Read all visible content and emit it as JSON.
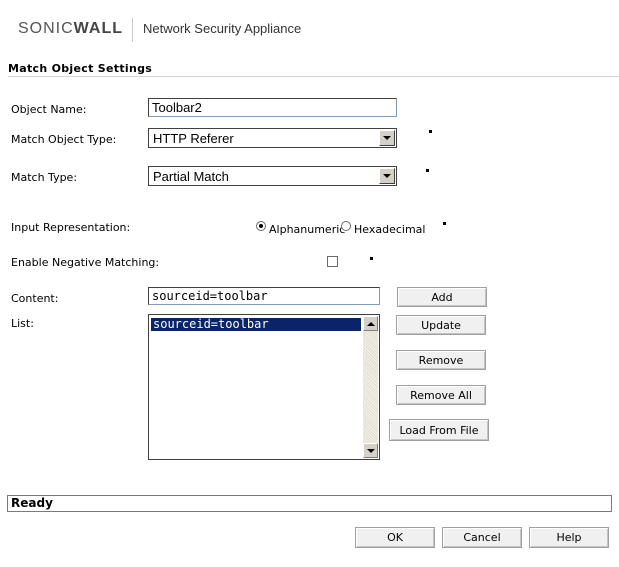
{
  "header": {
    "brand_prefix": "SONIC",
    "brand_suffix": "WALL",
    "product": "Network Security Appliance"
  },
  "section": {
    "title": "Match Object Settings"
  },
  "form": {
    "object_name": {
      "label": "Object Name:",
      "value": "Toolbar2"
    },
    "match_object_type": {
      "label": "Match Object Type:",
      "value": "HTTP Referer"
    },
    "match_type": {
      "label": "Match Type:",
      "value": "Partial Match"
    },
    "input_representation": {
      "label": "Input Representation:",
      "options": [
        "Alphanumeric",
        "Hexadecimal"
      ],
      "selected": "Alphanumeric"
    },
    "enable_negative_matching": {
      "label": "Enable Negative Matching:",
      "checked": false
    },
    "content": {
      "label": "Content:",
      "value": "sourceid=toolbar"
    },
    "list": {
      "label": "List:",
      "items": [
        "sourceid=toolbar"
      ],
      "selected_index": 0
    }
  },
  "buttons": {
    "add": "Add",
    "update": "Update",
    "remove": "Remove",
    "remove_all": "Remove All",
    "load_from_file": "Load From File",
    "ok": "OK",
    "cancel": "Cancel",
    "help": "Help"
  },
  "status": {
    "text": "Ready"
  },
  "colors": {
    "accent": "#ff6a00",
    "selection": "#0a246a"
  }
}
